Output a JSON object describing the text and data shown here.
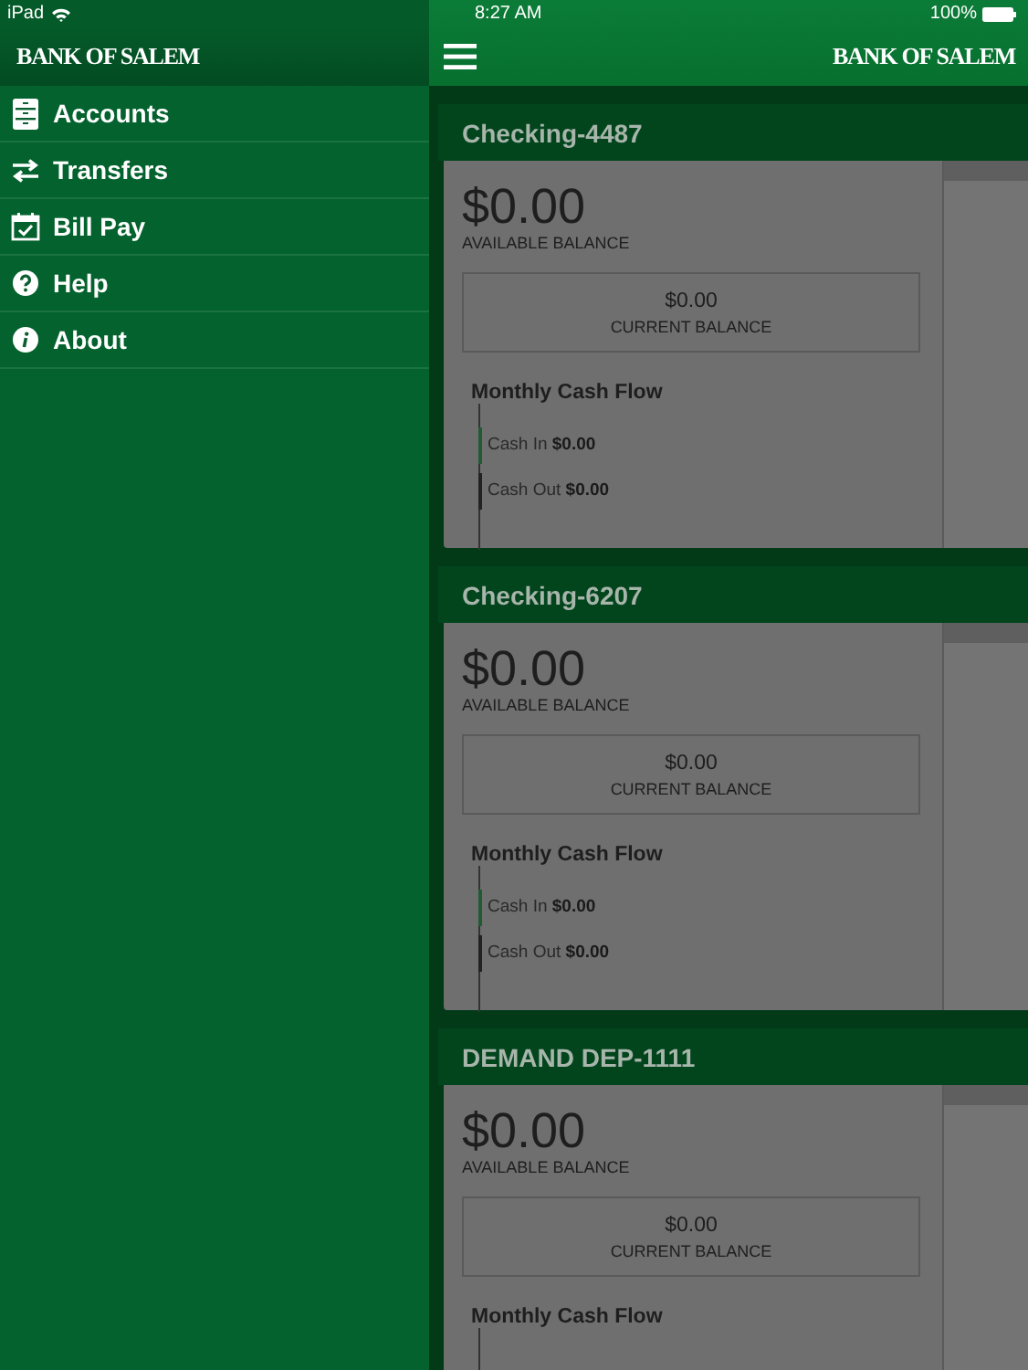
{
  "status_bar": {
    "device": "iPad",
    "time": "8:27 AM",
    "battery": "100%"
  },
  "sidebar": {
    "logo": "BANK OF SALEM",
    "items": [
      {
        "label": "Accounts"
      },
      {
        "label": "Transfers"
      },
      {
        "label": "Bill Pay"
      },
      {
        "label": "Help"
      },
      {
        "label": "About"
      }
    ]
  },
  "header": {
    "logo": "BANK OF SALEM"
  },
  "accounts": [
    {
      "name": "Checking-4487",
      "available": "$0.00",
      "available_label": "AVAILABLE BALANCE",
      "current": "$0.00",
      "current_label": "CURRENT BALANCE",
      "cash_flow_title": "Monthly Cash Flow",
      "cash_flow": [
        {
          "label": "Cash In",
          "amount": "$0.00",
          "color": "#1f5c33"
        },
        {
          "label": "Cash Out",
          "amount": "$0.00",
          "color": "#222222"
        }
      ]
    },
    {
      "name": "Checking-6207",
      "available": "$0.00",
      "available_label": "AVAILABLE BALANCE",
      "current": "$0.00",
      "current_label": "CURRENT BALANCE",
      "cash_flow_title": "Monthly Cash Flow",
      "cash_flow": [
        {
          "label": "Cash In",
          "amount": "$0.00",
          "color": "#1f5c33"
        },
        {
          "label": "Cash Out",
          "amount": "$0.00",
          "color": "#222222"
        }
      ]
    },
    {
      "name": "DEMAND DEP-1111",
      "available": "$0.00",
      "available_label": "AVAILABLE BALANCE",
      "current": "$0.00",
      "current_label": "CURRENT BALANCE",
      "cash_flow_title": "Monthly Cash Flow"
    }
  ]
}
